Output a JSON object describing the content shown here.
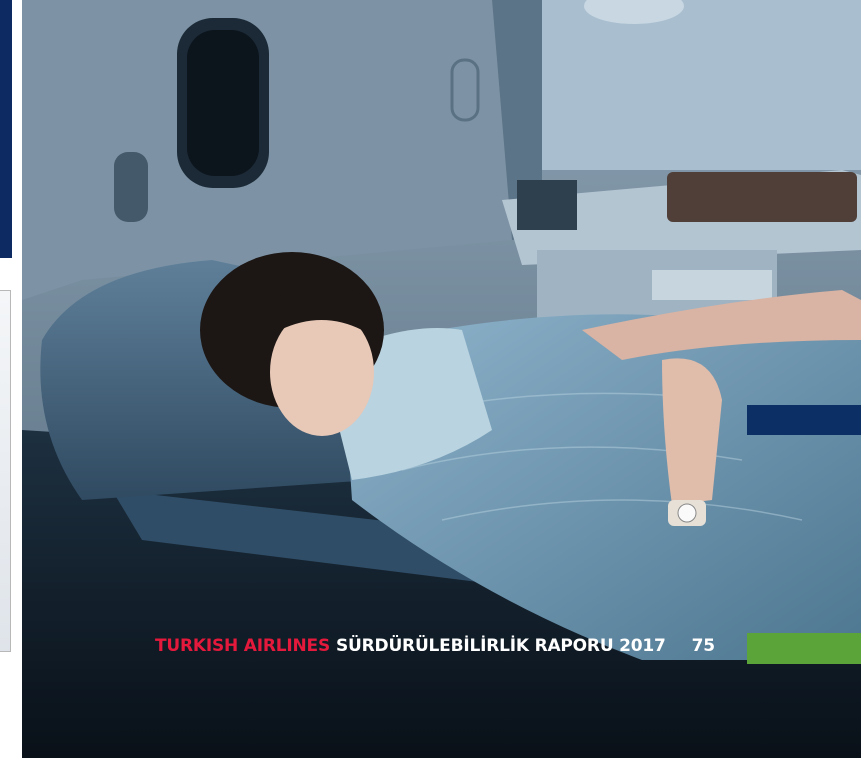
{
  "footer": {
    "brand": "TURKISH AIRLINES",
    "report_title": "SÜRDÜRÜLEBİLİRLİK RAPORU 2017",
    "page_number": "75"
  },
  "colors": {
    "brand_red": "#e4193c",
    "accent_navy": "#0c2f66",
    "accent_green": "#5aa43a"
  },
  "photo": {
    "subject": "woman-sleeping-in-business-class-seat-icon"
  }
}
